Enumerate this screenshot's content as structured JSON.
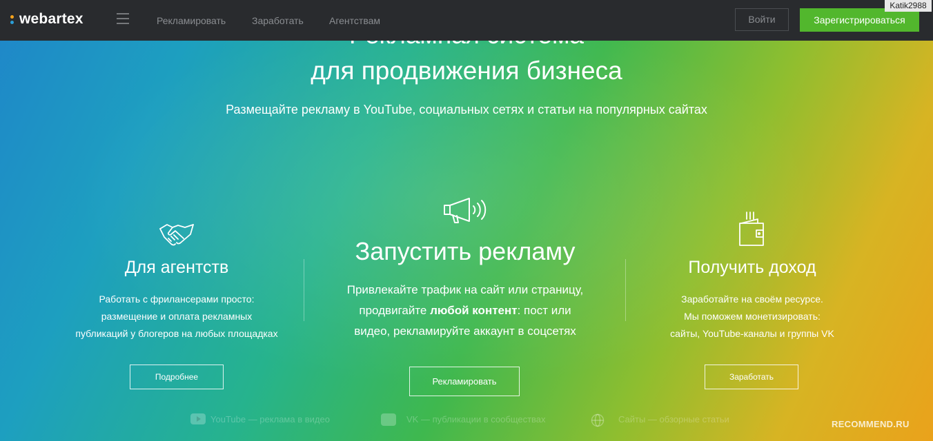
{
  "navbar": {
    "logo": "webartex",
    "links": [
      "Рекламировать",
      "Заработать",
      "Агентствам"
    ],
    "login": "Войти",
    "register": "Зарегистрироваться",
    "user_tag": "Katik2988"
  },
  "hero": {
    "title_line1": "Рекламная система",
    "title_line2": "для продвижения бизнеса",
    "subtitle": "Размещайте рекламу в YouTube, социальных сетях и статьи на популярных сайтах"
  },
  "columns": {
    "agencies": {
      "icon": "handshake-icon",
      "title": "Для агентств",
      "lines": [
        "Работать с фрилансерами просто:",
        "размещение и оплата рекламных",
        "публикаций у блогеров на любых площадках"
      ],
      "button": "Подробнее"
    },
    "launch": {
      "icon": "megaphone-icon",
      "title": "Запустить рекламу",
      "line1": "Привлекайте трафик на сайт или страницу,",
      "line2_pre": "продвигайте ",
      "line2_bold": "любой контент",
      "line2_post": ": пост или",
      "line3": "видео, рекламируйте аккаунт в соцсетях",
      "button": "Рекламировать"
    },
    "income": {
      "icon": "wallet-icon",
      "title": "Получить доход",
      "lines": [
        "Заработайте на своём ресурсе.",
        "Мы поможем монетизировать:",
        "сайты, YouTube-каналы и группы VK"
      ],
      "button": "Заработать"
    }
  },
  "footer": {
    "youtube": "YouTube — реклама в видео",
    "vk": "VK — публикации в сообществах",
    "sites": "Сайты — обзорные статьи"
  },
  "watermark": "RECOMMEND.RU"
}
